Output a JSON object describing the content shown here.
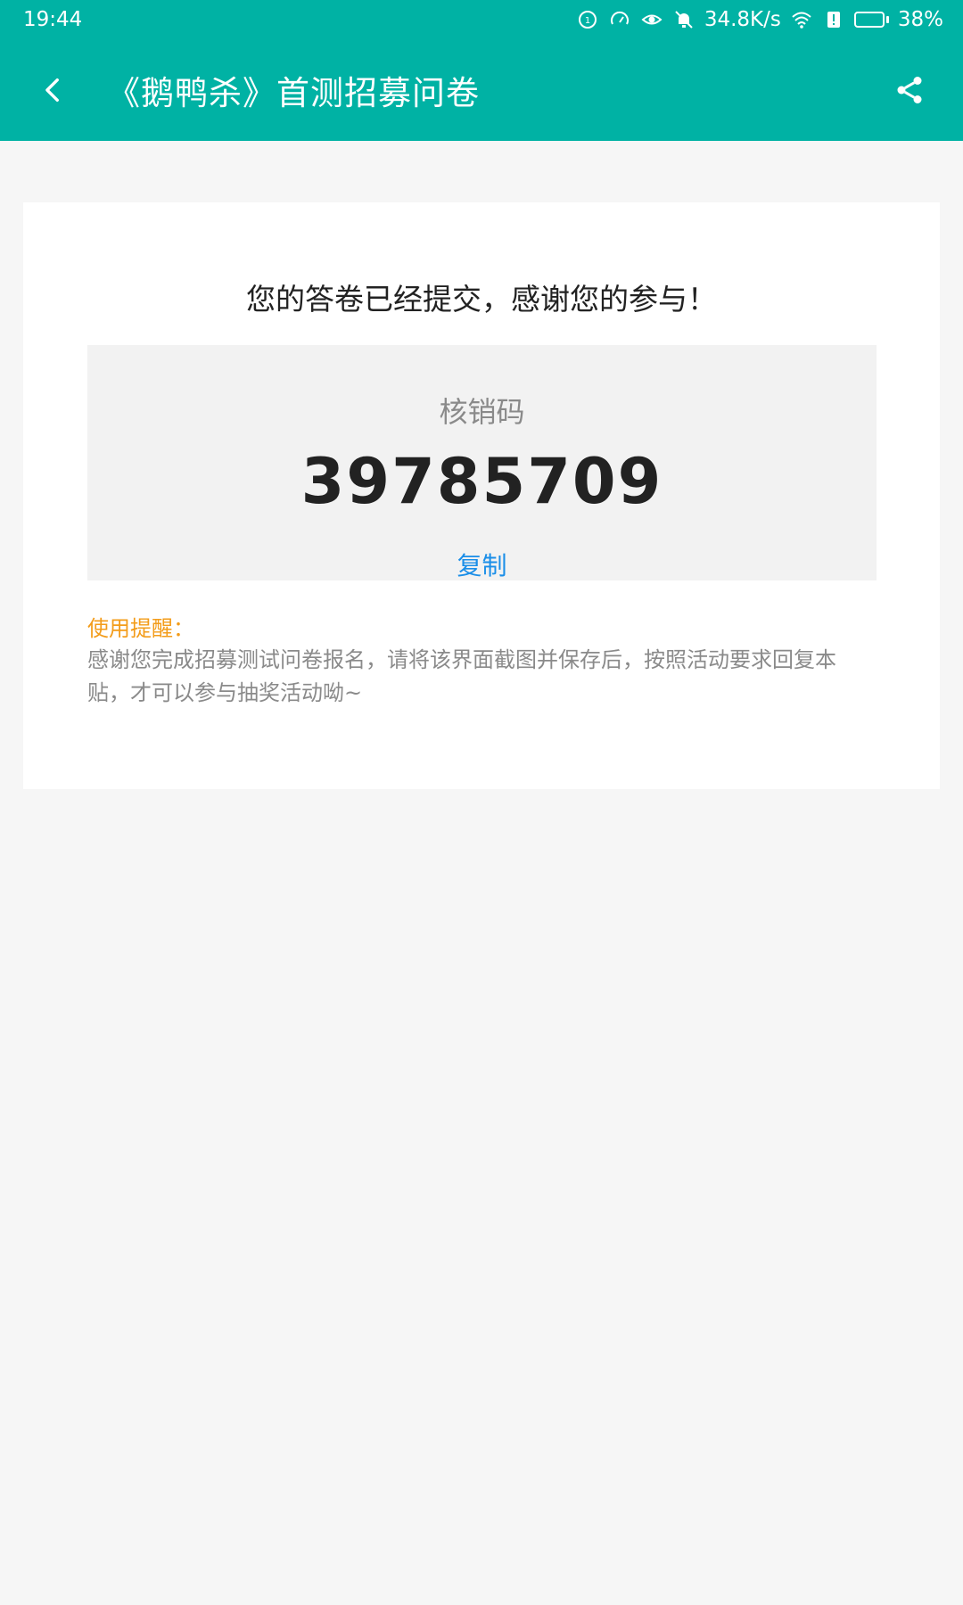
{
  "status_bar": {
    "time": "19:44",
    "network_speed": "34.8K/s",
    "battery_percent": "38%",
    "battery_level": 0.38,
    "icons": [
      "data-saver-icon",
      "speed-icon",
      "eye-icon",
      "mute-bell-icon",
      "wifi-icon",
      "alert-icon",
      "battery-icon"
    ]
  },
  "app_bar": {
    "title": "《鹅鸭杀》首测招募问卷",
    "back_icon": "back-chevron-icon",
    "share_icon": "share-icon"
  },
  "result": {
    "message": "您的答卷已经提交，感谢您的参与！",
    "code_label": "核销码",
    "code_value": "39785709",
    "copy_label": "复制",
    "tip_title": "使用提醒：",
    "tip_text": "感谢您完成招募测试问卷报名，请将该界面截图并保存后，按照活动要求回复本贴，才可以参与抽奖活动呦~"
  },
  "colors": {
    "primary": "#00b2a4",
    "accent_link": "#1a8ee8",
    "tip_title": "#f39c1a",
    "background": "#f6f6f6"
  }
}
